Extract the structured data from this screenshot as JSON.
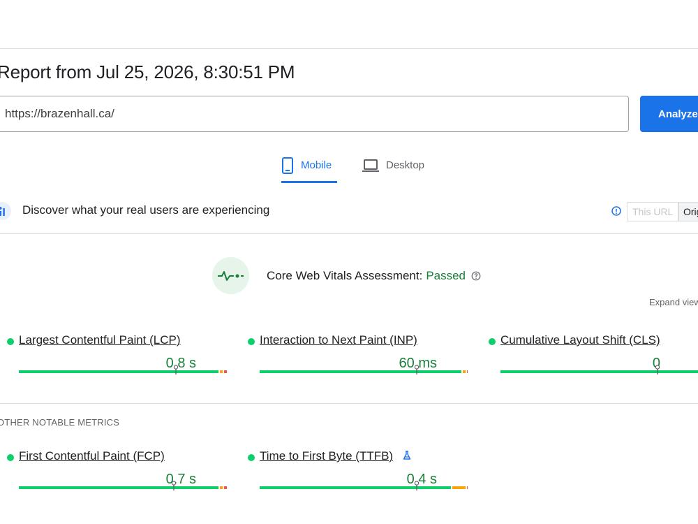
{
  "report": {
    "title": "Report from Jul 25, 2026, 8:30:51 PM"
  },
  "url_bar": {
    "value": "https://brazenhall.ca/",
    "analyze_label": "Analyze"
  },
  "tabs": [
    {
      "label": "Mobile",
      "active": true,
      "icon": "smartphone-icon"
    },
    {
      "label": "Desktop",
      "active": false,
      "icon": "laptop-icon"
    }
  ],
  "crux": {
    "title": "Discover what your real users are experiencing",
    "toggle": [
      {
        "label": "This URL",
        "selected": false
      },
      {
        "label": "Origin",
        "selected": true
      }
    ]
  },
  "cwv": {
    "label": "Core Web Vitals Assessment:",
    "status": "Passed",
    "expand_label": "Expand view"
  },
  "core_metrics": [
    {
      "label": "Largest Contentful Paint (LCP)",
      "value": "0.8 s",
      "status": "good",
      "distribution": {
        "good": 0.96,
        "needs_improvement": 0.02,
        "poor": 0.02
      },
      "marker": 0.75
    },
    {
      "label": "Interaction to Next Paint (INP)",
      "value": "60 ms",
      "status": "good",
      "distribution": {
        "good": 0.97,
        "needs_improvement": 0.02,
        "poor": 0.01
      },
      "marker": 0.75
    },
    {
      "label": "Cumulative Layout Shift (CLS)",
      "value": "0",
      "status": "good",
      "distribution": {
        "good": 1.0,
        "needs_improvement": 0.0,
        "poor": 0.0
      },
      "marker": 0.75
    }
  ],
  "other_metrics_heading": "OTHER NOTABLE METRICS",
  "other_metrics": [
    {
      "label": "First Contentful Paint (FCP)",
      "value": "0.7 s",
      "status": "good",
      "distribution": {
        "good": 0.96,
        "needs_improvement": 0.02,
        "poor": 0.02
      },
      "marker": 0.74
    },
    {
      "label": "Time to First Byte (TTFB)",
      "value": "0.4 s",
      "status": "good",
      "experimental": true,
      "distribution": {
        "good": 0.92,
        "needs_improvement": 0.07,
        "poor": 0.01
      },
      "marker": 0.75
    }
  ],
  "colors": {
    "accent": "#1a73e8",
    "good": "#0cce6b",
    "good_text": "#188038",
    "needs_improvement": "#ffa400",
    "poor": "#ff4e42"
  }
}
